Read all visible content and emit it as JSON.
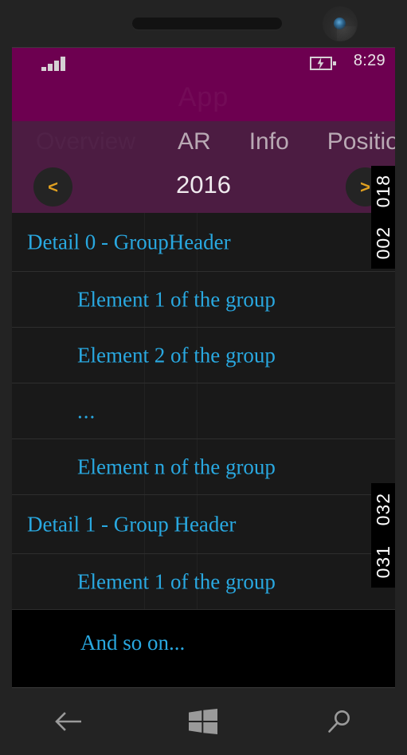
{
  "device": {
    "speaker": "speaker-grille",
    "camera": "front-camera"
  },
  "status_bar": {
    "signal_icon": "signal-bars-icon",
    "signal_bars": 4,
    "battery_icon": "battery-charging-icon",
    "time": "8:29"
  },
  "app": {
    "title": "App",
    "header_color": "#6d0050",
    "pivot_color": "#4c1c42"
  },
  "pivot": {
    "tabs": [
      {
        "label": "Overview",
        "faint": true
      },
      {
        "label": "AR",
        "faint": false
      },
      {
        "label": "Info",
        "faint": false
      },
      {
        "label": "Position",
        "faint": false
      }
    ]
  },
  "year_selector": {
    "prev_label": "<",
    "next_label": ">",
    "year": "2016",
    "accent_color": "#e0a020"
  },
  "list": {
    "text_color": "#29a8e0",
    "rows": [
      {
        "text": "Detail 0 - GroupHeader",
        "kind": "group-header"
      },
      {
        "text": "Element 1 of the group",
        "kind": "item"
      },
      {
        "text": "Element 2 of the group",
        "kind": "item"
      },
      {
        "text": "...",
        "kind": "ellipsis"
      },
      {
        "text": "Element n of the group",
        "kind": "item"
      },
      {
        "text": "Detail 1 - Group Header",
        "kind": "group-header"
      },
      {
        "text": "Element 1 of the group",
        "kind": "item"
      },
      {
        "text": "And so on...",
        "kind": "last-row"
      }
    ]
  },
  "edge_numbers": [
    {
      "value": "018"
    },
    {
      "value": "002"
    },
    {
      "value": "032"
    },
    {
      "value": "031"
    }
  ],
  "nav_bar": {
    "back_icon": "back-arrow-icon",
    "home_icon": "windows-logo-icon",
    "search_icon": "search-icon"
  }
}
